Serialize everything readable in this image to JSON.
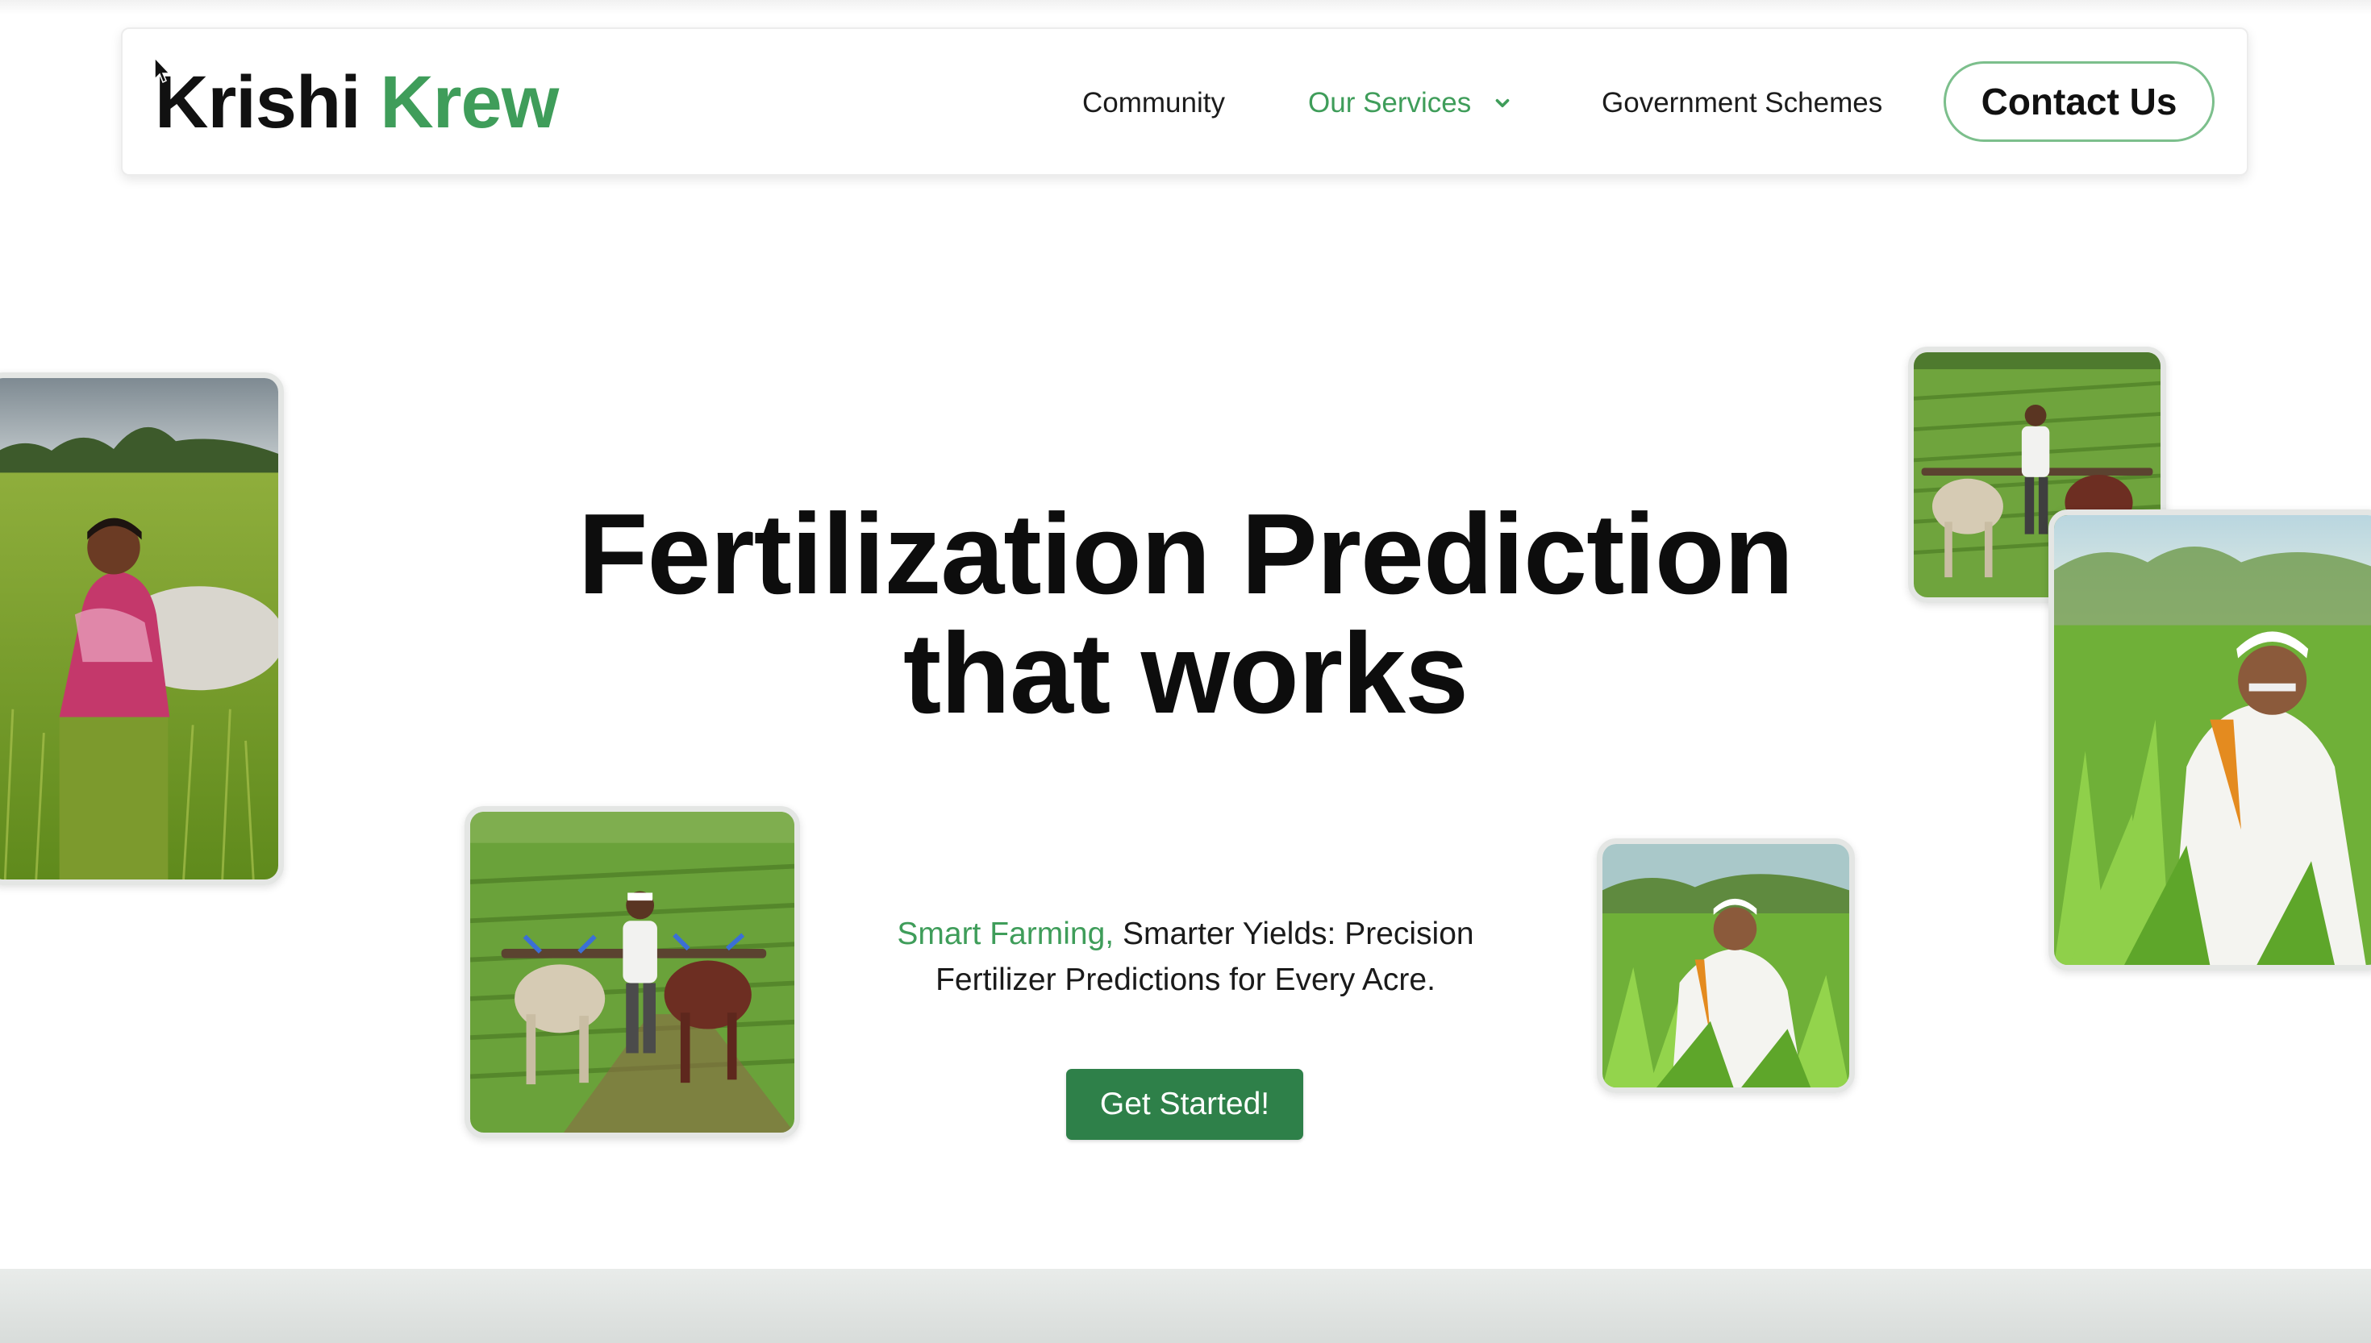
{
  "brand": {
    "name_part1": "Krishi",
    "name_part2": "Krew"
  },
  "nav": {
    "community": "Community",
    "services": "Our Services",
    "schemes": "Government Schemes",
    "contact": "Contact Us"
  },
  "hero": {
    "title_line1": "Fertilization Prediction",
    "title_line2": "that works",
    "subtitle_accent": "Smart Farming,",
    "subtitle_rest": "Smarter Yields: Precision",
    "subtitle_line2": "Fertilizer Predictions for Every Acre.",
    "cta": "Get Started!"
  },
  "icons": {
    "services_dropdown": "chevron-down-icon",
    "cursor": "mouse-cursor-icon"
  },
  "colors": {
    "brand_green": "#3f9d5a",
    "cta_green": "#2e8049",
    "contact_border": "#7cbf8c",
    "text_dark": "#111111"
  }
}
